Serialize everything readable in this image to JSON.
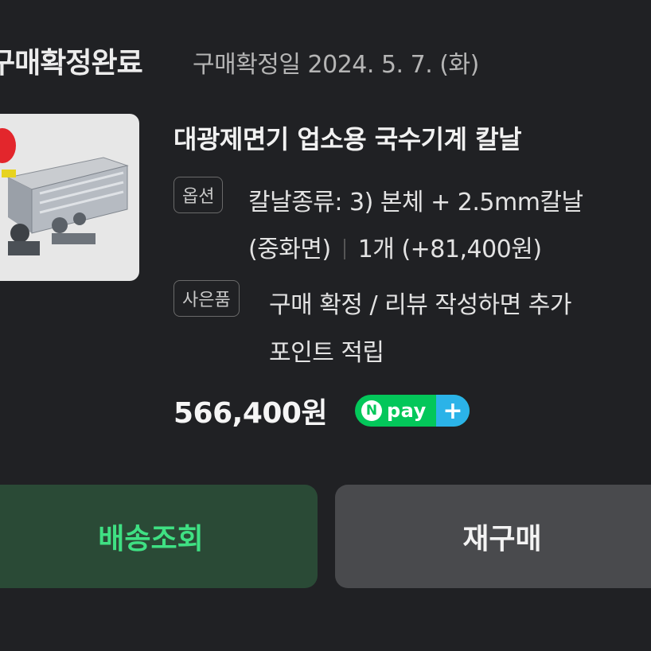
{
  "order": {
    "status": "구매확정완료",
    "confirm_date": "구매확정일 2024. 5. 7. (화)"
  },
  "product": {
    "title": "대광제면기 업소용 국수기계 칼날",
    "option_tag": "옵션",
    "option_line1": "칼날종류: 3) 본체 + 2.5mm칼날",
    "option_variant": "(중화면)",
    "option_qty_price": "1개 (+81,400원)",
    "gift_tag": "사은품",
    "gift_line1": "구매 확정 / 리뷰 작성하면 추가",
    "gift_line2": "포인트 적립",
    "price": "566,400원"
  },
  "npay": {
    "n": "N",
    "pay": "pay",
    "plus": "+"
  },
  "buttons": {
    "track_label": "배송조회",
    "rebuy_label": "재구매"
  },
  "colors": {
    "background": "#202124",
    "track_button_bg": "#2a4a36",
    "track_button_text": "#3fe083",
    "rebuy_button_bg": "#494a4d",
    "npay_green": "#03c75a",
    "npay_blue": "#2bb3e8"
  }
}
